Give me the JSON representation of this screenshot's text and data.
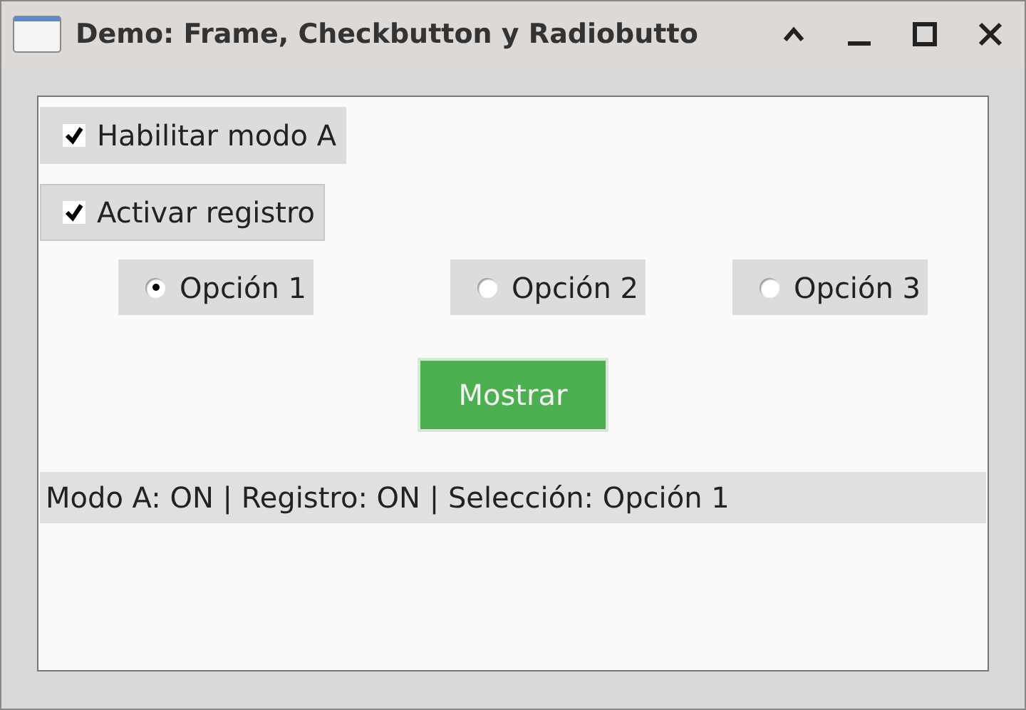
{
  "window": {
    "title": "Demo: Frame, Checkbutton y Radiobutto"
  },
  "checkbuttons": [
    {
      "label": "Habilitar modo A",
      "checked": true,
      "focused": false
    },
    {
      "label": "Activar registro",
      "checked": true,
      "focused": true
    }
  ],
  "radiobuttons": [
    {
      "label": "Opción 1",
      "selected": true
    },
    {
      "label": "Opción 2",
      "selected": false
    },
    {
      "label": "Opción 3",
      "selected": false
    }
  ],
  "button": {
    "label": "Mostrar"
  },
  "status": "Modo A: ON | Registro: ON | Selección: Opción 1"
}
